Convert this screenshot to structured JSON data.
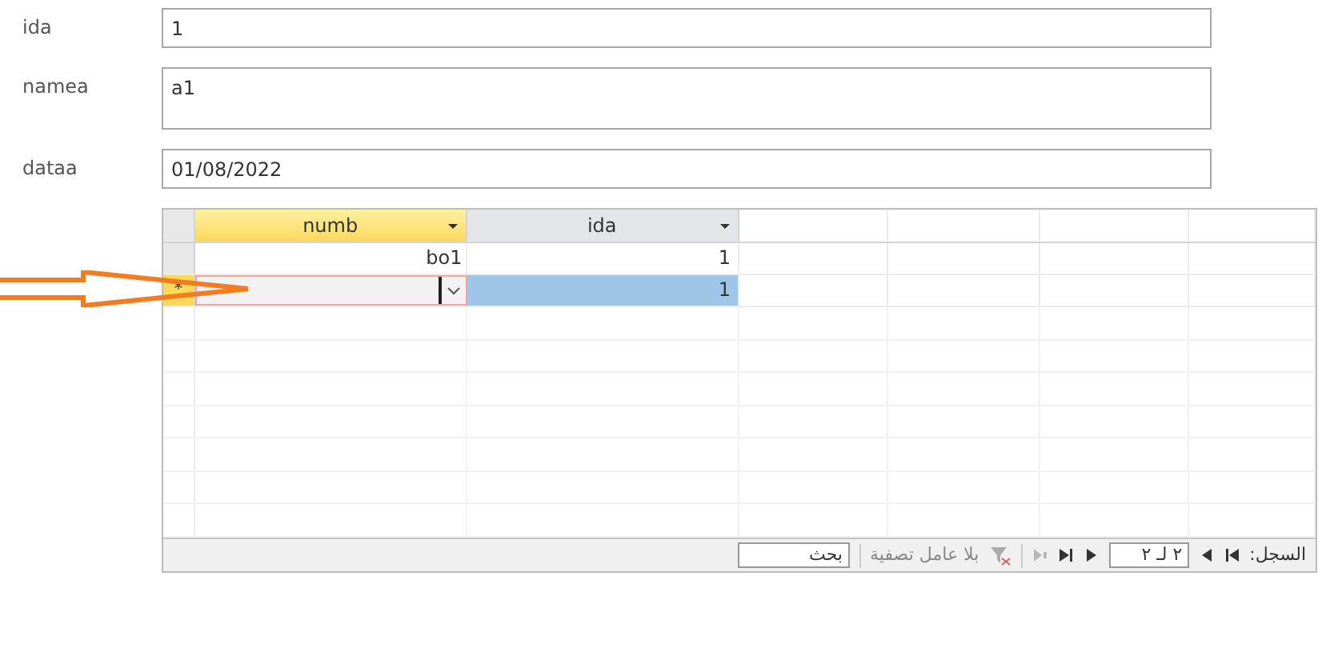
{
  "form": {
    "fields": [
      {
        "label": "ida",
        "value": "1",
        "kind": "single"
      },
      {
        "label": "namea",
        "value": "a1",
        "kind": "multi"
      },
      {
        "label": "dataa",
        "value": "01/08/2022",
        "kind": "single"
      }
    ]
  },
  "datasheet": {
    "columns": {
      "numb": {
        "label": "numb",
        "selected": true
      },
      "ida": {
        "label": "ida",
        "selected": false
      }
    },
    "rows": [
      {
        "kind": "record",
        "numb": "bo1",
        "ida": "1",
        "selected": false
      },
      {
        "kind": "new",
        "marker": "*",
        "ida": "1",
        "selected": true
      }
    ],
    "navigator": {
      "label": "السجل:",
      "position": "٢ لـ ٢",
      "new_disabled": true,
      "filter": "بلا عامل تصفية",
      "search": "بحث"
    }
  }
}
